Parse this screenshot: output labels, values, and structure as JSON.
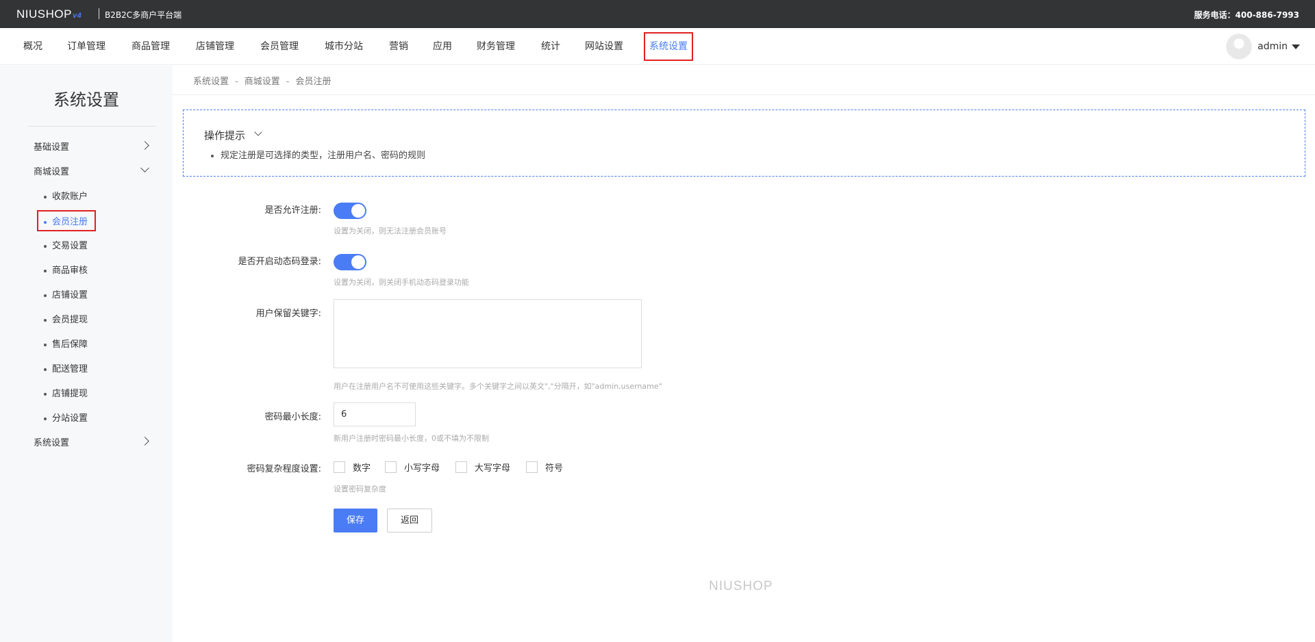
{
  "topbar": {
    "logo_text": "NIUSHOP",
    "logo_version": "v4",
    "platform": "B2B2C多商户平台端",
    "hotline": "服务电话：400-886-7993"
  },
  "nav": {
    "items": [
      "概况",
      "订单管理",
      "商品管理",
      "店铺管理",
      "会员管理",
      "城市分站",
      "营销",
      "应用",
      "财务管理",
      "统计",
      "网站设置",
      "系统设置"
    ],
    "active": "系统设置",
    "user": "admin"
  },
  "sidebar": {
    "title": "系统设置",
    "groups": [
      {
        "label": "基础设置",
        "state": "collapsed"
      },
      {
        "label": "商城设置",
        "state": "expanded"
      },
      {
        "label": "系统设置",
        "state": "collapsed"
      }
    ],
    "sub_items": [
      "收款账户",
      "会员注册",
      "交易设置",
      "商品审核",
      "店铺设置",
      "会员提现",
      "售后保障",
      "配送管理",
      "店铺提现",
      "分站设置"
    ],
    "active_sub": "会员注册"
  },
  "breadcrumb": {
    "items": [
      "系统设置",
      "商城设置",
      "会员注册"
    ],
    "separator": "-"
  },
  "tips": {
    "title": "操作提示",
    "item": "规定注册是可选择的类型，注册用户名、密码的规则"
  },
  "form": {
    "allow_register": {
      "label": "是否允许注册:",
      "enabled": true,
      "hint": "设置为关闭，则无法注册会员账号"
    },
    "dynamic_login": {
      "label": "是否开启动态码登录:",
      "enabled": true,
      "hint": "设置为关闭，则关闭手机动态码登录功能"
    },
    "reserved_keywords": {
      "label": "用户保留关键字:",
      "value": "",
      "hint": "用户在注册用户名不可使用这些关键字。多个关键字之间以英文\",\"分隔开，如\"admin,username\""
    },
    "min_length": {
      "label": "密码最小长度:",
      "value": "6",
      "hint": "新用户注册时密码最小长度，0或不填为不限制"
    },
    "complexity": {
      "label": "密码复杂程度设置:",
      "options": [
        "数字",
        "小写字母",
        "大写字母",
        "符号"
      ],
      "hint": "设置密码复杂度"
    }
  },
  "buttons": {
    "save": "保存",
    "back": "返回"
  },
  "footer": {
    "logo": "NIUSHOP"
  },
  "colors": {
    "accent": "#4a7cf5",
    "highlight_border": "#e02020",
    "topbar": "#333436"
  }
}
